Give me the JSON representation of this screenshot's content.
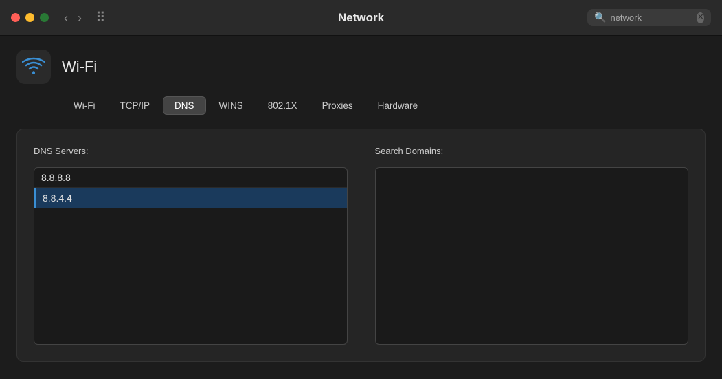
{
  "titlebar": {
    "title": "Network",
    "search_placeholder": "network",
    "nav_back": "‹",
    "nav_forward": "›",
    "grid_label": "⠿"
  },
  "traffic_lights": {
    "close": "close",
    "minimize": "minimize",
    "maximize": "maximize"
  },
  "wifi": {
    "label": "Wi-Fi"
  },
  "tabs": [
    {
      "id": "wifi",
      "label": "Wi-Fi",
      "active": false
    },
    {
      "id": "tcpip",
      "label": "TCP/IP",
      "active": false
    },
    {
      "id": "dns",
      "label": "DNS",
      "active": true
    },
    {
      "id": "wins",
      "label": "WINS",
      "active": false
    },
    {
      "id": "8021x",
      "label": "802.1X",
      "active": false
    },
    {
      "id": "proxies",
      "label": "Proxies",
      "active": false
    },
    {
      "id": "hardware",
      "label": "Hardware",
      "active": false
    }
  ],
  "dns_section": {
    "label": "DNS Servers:",
    "entries": [
      {
        "value": "8.8.8.8",
        "selected": false
      },
      {
        "value": "8.8.4.4",
        "selected": true
      }
    ]
  },
  "search_domains_section": {
    "label": "Search Domains:",
    "entries": []
  }
}
